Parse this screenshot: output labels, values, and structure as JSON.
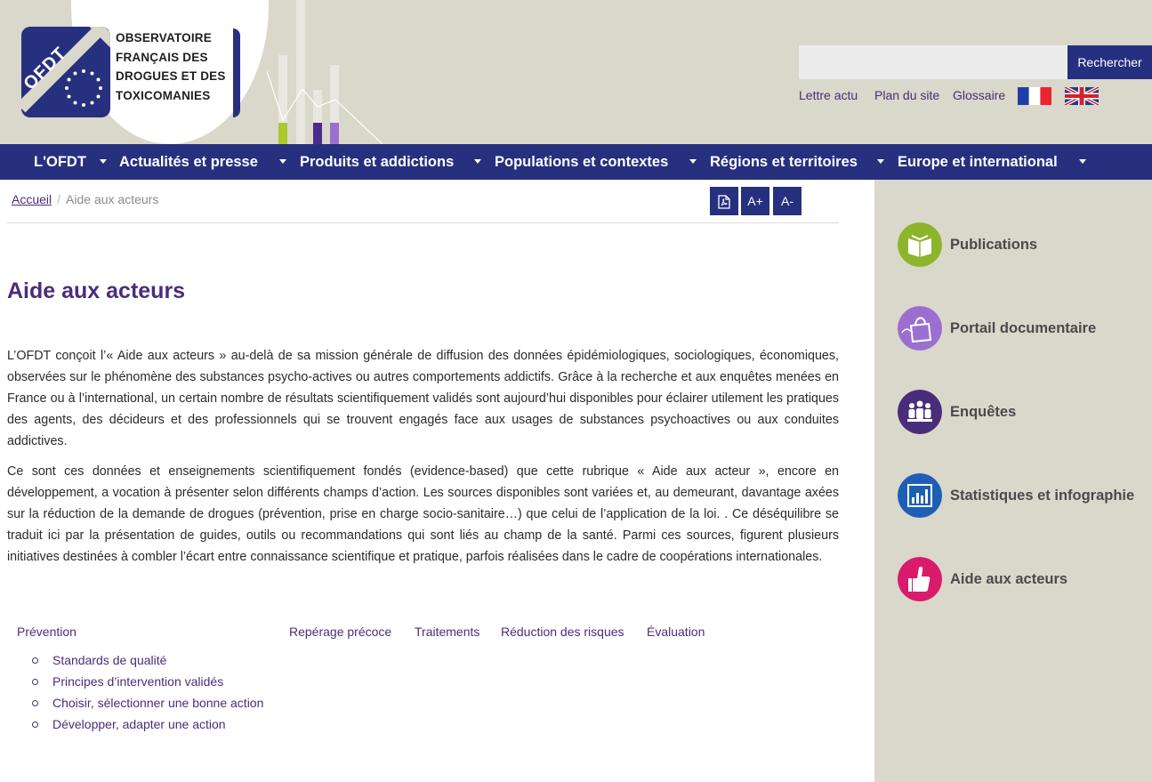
{
  "header": {
    "logo": {
      "mark_text": "OFDT",
      "lines": [
        "OBSERVATOIRE",
        "FRANÇAIS DES",
        "DROGUES ET DES",
        "TOXICOMANIES"
      ]
    },
    "search": {
      "placeholder": "",
      "button_label": "Rechercher"
    },
    "links": [
      "Lettre actu",
      "Plan du site",
      "Glossaire"
    ],
    "flags": [
      "france-flag-icon",
      "uk-flag-icon"
    ]
  },
  "nav": {
    "items": [
      "L'OFDT",
      "Actualités et presse",
      "Produits et addictions",
      "Populations et contextes",
      "Régions et territoires",
      "Europe et international"
    ]
  },
  "breadcrumb": {
    "home": "Accueil",
    "separator": "/",
    "current": "Aide aux acteurs"
  },
  "tools": {
    "pdf_icon": "pdf-icon",
    "increase": "A+",
    "decrease": "A-"
  },
  "main": {
    "title": "Aide aux acteurs",
    "paragraphs": [
      "L’OFDT conçoit l’« Aide aux acteurs » au-delà de sa mission générale de diffusion des données épidémiologiques, sociologiques, économiques, observées sur le phénomène des substances psycho-actives ou autres comportements addictifs. Grâce à la recherche et aux enquêtes menées en France ou à l’international, un certain nombre de résultats scientifiquement validés sont aujourd’hui disponibles pour éclairer utilement les pratiques des agents, des décideurs et des professionnels qui se trouvent engagés face aux usages de substances psychoactives ou aux conduites addictives.",
      "Ce sont ces données et enseignements scientifiquement fondés (evidence-based) que cette rubrique « Aide aux acteur », encore en développement, a vocation à présenter selon différents champs d’action. Les sources disponibles sont variées et, au demeurant, davantage axées sur la réduction de la demande de drogues (prévention, prise en charge socio-sanitaire…) que celui de l’application de la loi. . Ce déséquilibre se traduit ici par la présentation de guides, outils ou recommandations qui sont liés au champ de la santé. Parmi ces sources, figurent plusieurs initiatives destinées à combler l’écart entre connaissance scientifique et pratique, parfois réalisées dans le cadre de coopérations internationales."
    ],
    "tabs": [
      "Prévention",
      "Repérage précoce",
      "Traitements",
      "Réduction des risques",
      "Évaluation"
    ],
    "prevention_items": [
      "Standards de qualité",
      "Principes d’intervention validés",
      "Choisir, sélectionner une bonne action",
      "Développer, adapter une action"
    ]
  },
  "sidebar": {
    "items": [
      {
        "label": "Publications",
        "icon": "book-icon",
        "color": "#8db52c"
      },
      {
        "label": "Portail documentaire",
        "icon": "bag-icon",
        "color": "#9b6fd0"
      },
      {
        "label": "Enquêtes",
        "icon": "people-icon",
        "color": "#4a2d7a"
      },
      {
        "label": "Statistiques et infographie",
        "icon": "bar-chart-icon",
        "color": "#1d5fb5"
      },
      {
        "label": "Aide aux acteurs",
        "icon": "thumbs-up-icon",
        "color": "#d81b6b"
      }
    ]
  },
  "colors": {
    "nav_bg": "#27307e",
    "header_bg": "#dad7cb",
    "title_purple": "#4a2d7a",
    "link_purple": "#4a2d7a"
  }
}
